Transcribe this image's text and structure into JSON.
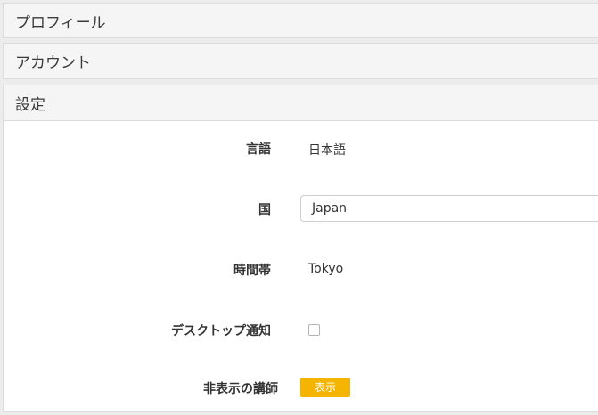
{
  "sections": {
    "profile": {
      "title": "プロフィール"
    },
    "account": {
      "title": "アカウント"
    },
    "settings": {
      "title": "設定"
    }
  },
  "settings_form": {
    "language": {
      "label": "言語",
      "value": "日本語"
    },
    "country": {
      "label": "国",
      "value": "Japan"
    },
    "timezone": {
      "label": "時間帯",
      "value": "Tokyo"
    },
    "desktop_notification": {
      "label": "デスクトップ通知",
      "checked": false
    },
    "hidden_teachers": {
      "label": "非表示の講師",
      "button_label": "表示"
    }
  },
  "colors": {
    "show_button": "#f4b400",
    "header_background": "#f5f5f5",
    "page_background": "#ececec"
  }
}
